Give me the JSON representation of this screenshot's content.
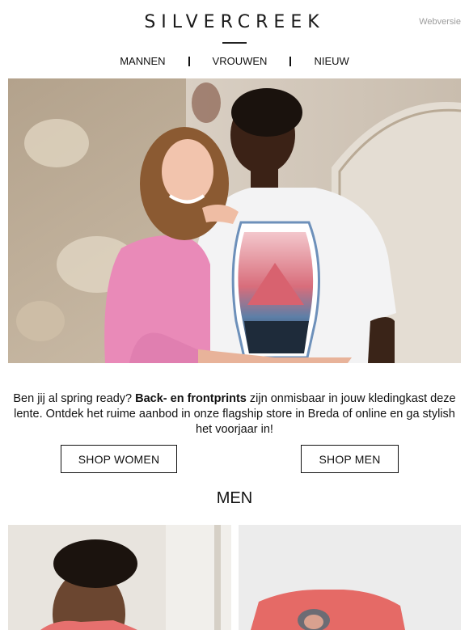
{
  "header": {
    "brand": "SILVERCREEK",
    "webversion_link": "Webversie"
  },
  "nav": {
    "items": [
      {
        "label": "MANNEN"
      },
      {
        "label": "VROUWEN"
      },
      {
        "label": "NIEUW"
      }
    ]
  },
  "intro": {
    "part1": "Ben jij al spring ready? ",
    "bold": "Back- en frontprints",
    "part2": " zijn onmisbaar in jouw kledingkast deze lente. Ontdek het ruime aanbod in onze flagship store in Breda of online en ga stylish het voorjaar in!"
  },
  "buttons": {
    "shop_women": "SHOP WOMEN",
    "shop_men": "SHOP MEN"
  },
  "section": {
    "title": "MEN"
  }
}
